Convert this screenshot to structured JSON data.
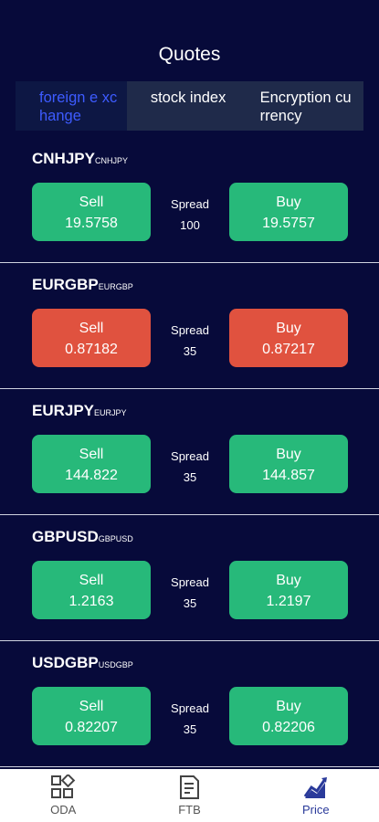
{
  "header": {
    "title": "Quotes"
  },
  "tabs": [
    {
      "label": "foreign e xchange",
      "active": true
    },
    {
      "label": "stock index",
      "active": false
    },
    {
      "label": "Encryption currency",
      "active": false
    }
  ],
  "colors": {
    "up": "#27b97a",
    "down": "#e0523f",
    "background": "#070a3a",
    "accent": "#3d5bff"
  },
  "quotes": [
    {
      "symbol": "CNHJPY",
      "code": "CNHJPY",
      "sell_label": "Sell",
      "sell": "19.5758",
      "spread_label": "Spread",
      "spread": "100",
      "buy_label": "Buy",
      "buy": "19.5757",
      "color": "green"
    },
    {
      "symbol": "EURGBP",
      "code": "EURGBP",
      "sell_label": "Sell",
      "sell": "0.87182",
      "spread_label": "Spread",
      "spread": "35",
      "buy_label": "Buy",
      "buy": "0.87217",
      "color": "red"
    },
    {
      "symbol": "EURJPY",
      "code": "EURJPY",
      "sell_label": "Sell",
      "sell": "144.822",
      "spread_label": "Spread",
      "spread": "35",
      "buy_label": "Buy",
      "buy": "144.857",
      "color": "green"
    },
    {
      "symbol": "GBPUSD",
      "code": "GBPUSD",
      "sell_label": "Sell",
      "sell": "1.2163",
      "spread_label": "Spread",
      "spread": "35",
      "buy_label": "Buy",
      "buy": "1.2197",
      "color": "green"
    },
    {
      "symbol": "USDGBP",
      "code": "USDGBP",
      "sell_label": "Sell",
      "sell": "0.82207",
      "spread_label": "Spread",
      "spread": "35",
      "buy_label": "Buy",
      "buy": "0.82206",
      "color": "green"
    }
  ],
  "bottom_nav": [
    {
      "label": "ODA",
      "icon": "grid-icon",
      "active": false
    },
    {
      "label": "FTB",
      "icon": "document-icon",
      "active": false
    },
    {
      "label": "Price",
      "icon": "chart-icon",
      "active": true
    }
  ]
}
